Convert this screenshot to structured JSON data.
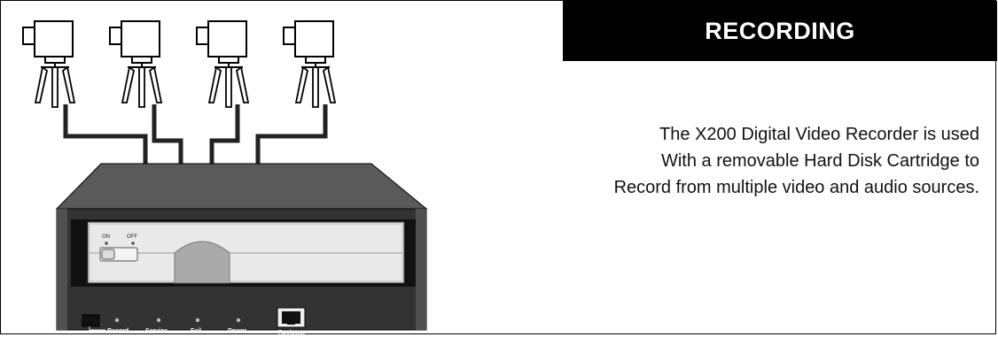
{
  "title": "RECORDING",
  "description": {
    "line1": "The X200 Digital Video Recorder is used",
    "line2": "With a removable Hard Disk Cartridge to",
    "line3": "Record from multiple video and audio sources."
  },
  "device": {
    "switch_on": "ON",
    "switch_off": "OFF",
    "indicators": [
      "Record",
      "Service",
      "Fail",
      "Power"
    ],
    "port_label": "Reviewer"
  },
  "icons": [
    "video-camera-icon",
    "tripod-icon",
    "hard-disk-cartridge-icon",
    "ethernet-port-icon",
    "led-indicator-icon"
  ],
  "colors": {
    "title_background": "#000000",
    "title_text": "#ffffff",
    "device_body": "#444444",
    "device_top": "#5a5a5a",
    "cartridge": "#e9e9e9"
  }
}
